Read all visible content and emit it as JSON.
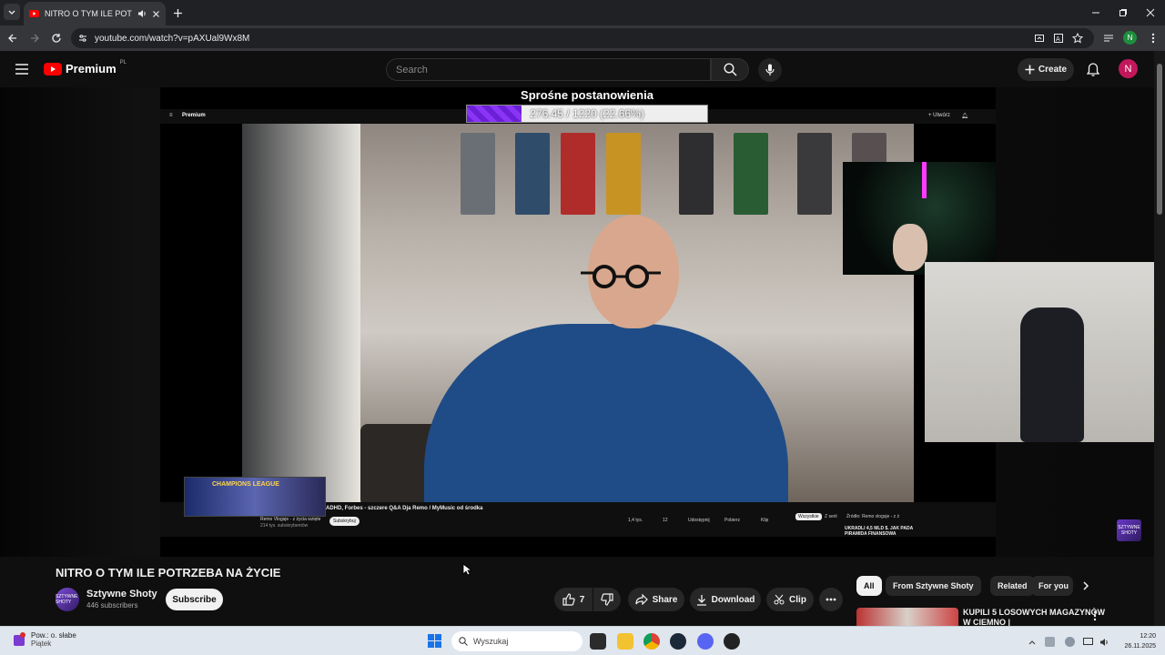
{
  "browser": {
    "tab_title": "NITRO O TYM ILE POTRZEBA",
    "url": "youtube.com/watch?v=pAXUal9Wx8M",
    "profile_initial": "N"
  },
  "header": {
    "logo_text": "Premium",
    "logo_region": "PL",
    "search_placeholder": "Search",
    "create_label": "Create",
    "avatar_initial": "N"
  },
  "stream_overlay": {
    "title": "Sprośne postanowienia",
    "progress_text": "276.45 / 1220 (22.66%)",
    "progress_fraction": 0.2266,
    "fill_color": "#7a2ae8"
  },
  "inner_video": {
    "header_premium": "Premium",
    "header_create": "+ Utwórz",
    "thumb_text": "CHAMPIONS LEAGUE",
    "video_title": "ADHD, Forbes - szczere Q&A Dja Remo / MyMusic od środka",
    "channel": "Remo Vlogsje - z życia wzięte",
    "subs": "214 tys. subskrybentów",
    "subscribe": "Subskrybuj",
    "likes": "1,4 tys.",
    "comments": "12",
    "share": "Udostępnij",
    "download": "Pobierz",
    "clip": "Klip",
    "chip_all": "Wszystkie",
    "chip_from": "Z serii",
    "chip_related": "Źródło: Remo vlogsje - z ż",
    "side_title": "UKRADLI 4,5 MLD $. JAK PADA",
    "side_sub": "PIRAMIDA FINANSOWA"
  },
  "corner_logo_text": "SZTYWNE SHOTY",
  "video": {
    "title": "NITRO O TYM ILE POTRZEBA NA ŻYCIE",
    "channel_name": "Sztywne Shoty",
    "channel_avatar_text": "SZTYWNE SHOTY",
    "subscribers": "446 subscribers",
    "subscribe_label": "Subscribe",
    "like_count": "7",
    "share_label": "Share",
    "download_label": "Download",
    "clip_label": "Clip"
  },
  "chips": [
    "All",
    "From Sztywne Shoty",
    "Related",
    "For you"
  ],
  "recommended": {
    "title": "KUPILI 5 LOSOWYCH MAGAZYNÓW W CIEMNO |"
  },
  "taskbar": {
    "weather_line1": "Pow.: o. słabe",
    "weather_line2": "Piątek",
    "search_placeholder": "Wyszukaj",
    "time": "12:20",
    "date": "26.11.2025"
  },
  "colors": {
    "yt_red": "#ff0000",
    "accent_purple": "#7a2ae8",
    "avatar_pink": "#c2185b"
  }
}
